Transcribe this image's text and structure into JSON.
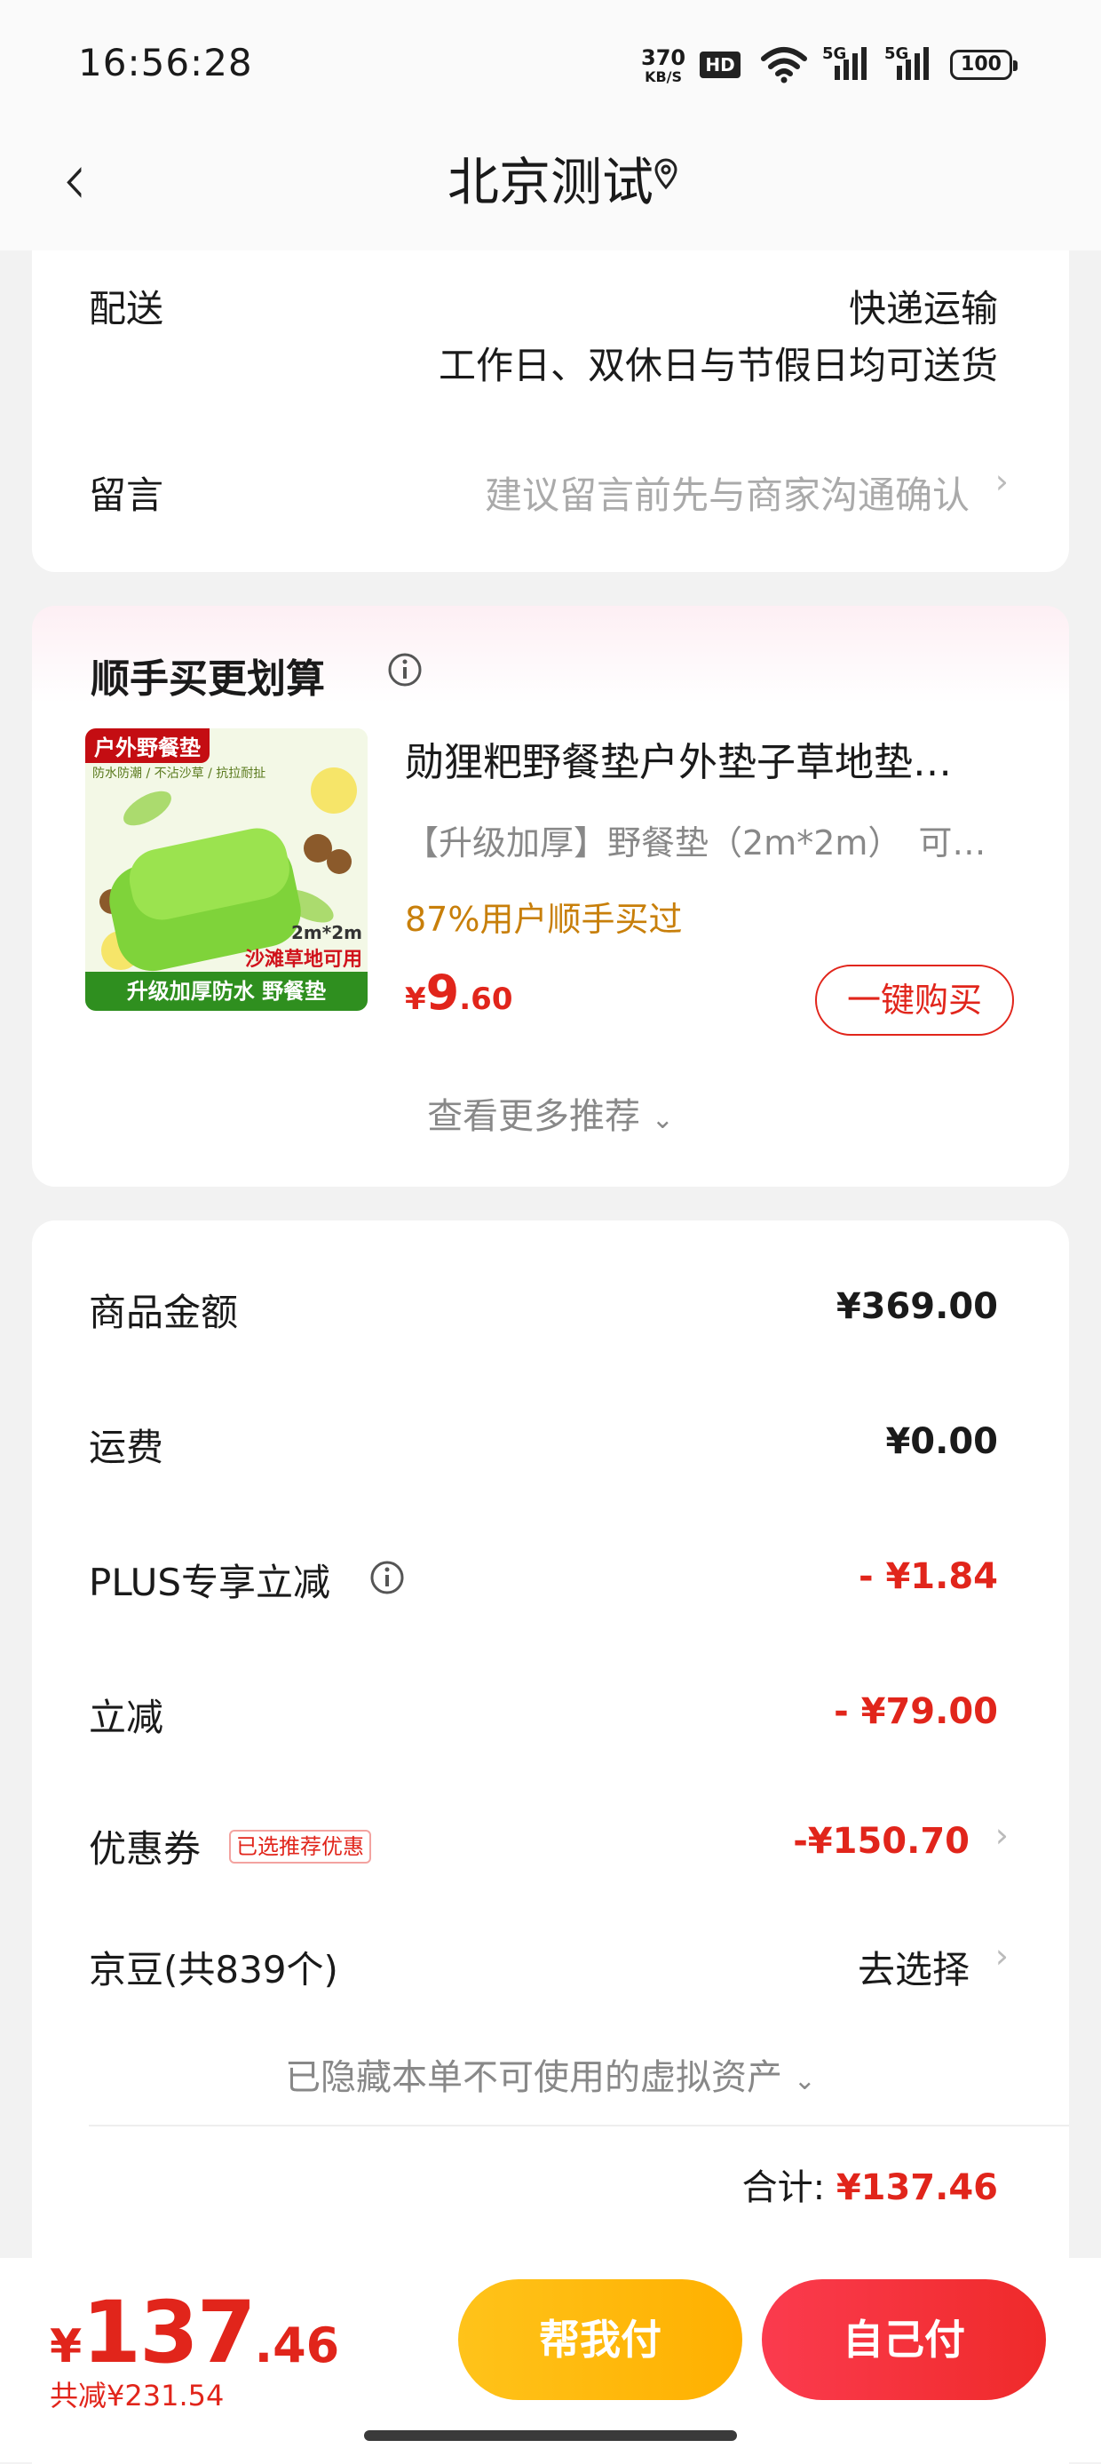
{
  "status_bar": {
    "time": "16:56:28",
    "net_speed_value": "370",
    "net_speed_unit": "KB/S",
    "hd_label": "HD",
    "signal1_label": "5G",
    "signal2_label": "5G",
    "battery": "100"
  },
  "header": {
    "back_icon": "chevron-left-icon",
    "title": "北京测试",
    "location_icon": "location-pin-icon"
  },
  "delivery": {
    "label": "配送",
    "method": "快递运输",
    "schedule": "工作日、双休日与节假日均可送货"
  },
  "message": {
    "label": "留言",
    "placeholder": "建议留言前先与商家沟通确认"
  },
  "recommend": {
    "title": "顺手买更划算",
    "info_icon": "info-icon",
    "product_title": "勋狸粑野餐垫户外垫子草地垫…",
    "product_desc": "【升级加厚】野餐垫（2m*2m）　可…",
    "buy_rate": "87%用户顺手买过",
    "price_symbol": "¥",
    "price_int": "9",
    "price_dec": ".60",
    "buy_button": "一键购买",
    "more": "查看更多推荐",
    "image_text": {
      "tag": "户外野餐垫",
      "features": "防水防潮 / 不沾沙草 / 抗拉耐扯",
      "size": "2m*2m",
      "usage": "沙滩草地可用",
      "bottom": "升级加厚防水 野餐垫"
    }
  },
  "summary": {
    "rows": [
      {
        "label": "商品金额",
        "value": "¥369.00"
      },
      {
        "label": "运费",
        "value": "¥0.00"
      },
      {
        "label": "PLUS专享立减",
        "value": "- ¥1.84"
      },
      {
        "label": "立减",
        "value": "- ¥79.00"
      }
    ],
    "coupon": {
      "label": "优惠券",
      "badge": "已选推荐优惠",
      "value": "-¥150.70"
    },
    "jingdou": {
      "label": "京豆(共839个)",
      "value": "去选择"
    },
    "hidden_note": "已隐藏本单不可使用的虚拟资产",
    "total_label": "合计:",
    "total_value": "¥137.46"
  },
  "bottom_bar": {
    "currency": "¥",
    "amount_int": "137",
    "amount_dec": ".46",
    "saved": "共减¥231.54",
    "help_pay": "帮我付",
    "self_pay": "自己付"
  },
  "colors": {
    "accent_red": "#e1251b",
    "orange": "#c87f0a",
    "yellow_button": "#ffb800"
  }
}
